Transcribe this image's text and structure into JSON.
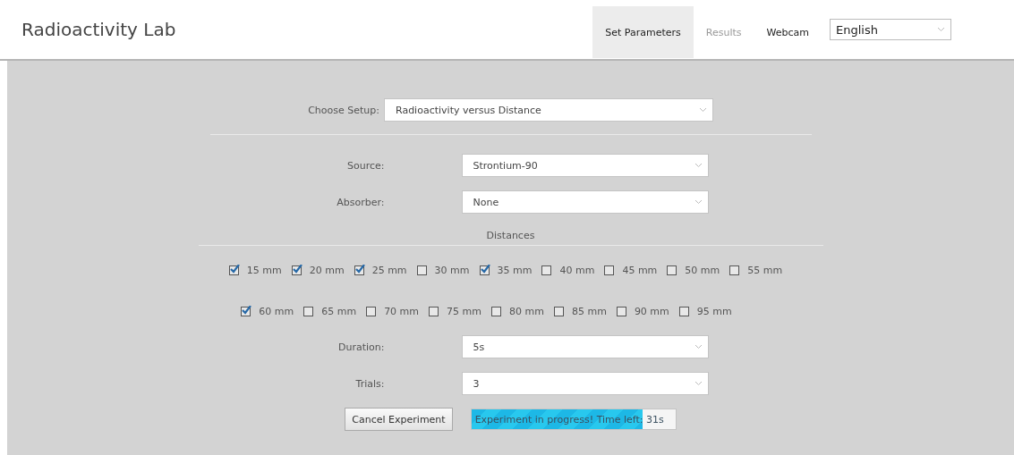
{
  "header": {
    "title": "Radioactivity Lab",
    "tabs": [
      {
        "label": "Set Parameters",
        "selected": true,
        "disabled": false
      },
      {
        "label": "Results",
        "selected": false,
        "disabled": true
      },
      {
        "label": "Webcam",
        "selected": false,
        "disabled": false
      }
    ],
    "language": "English"
  },
  "setup": {
    "label": "Choose Setup:",
    "value": "Radioactivity versus Distance"
  },
  "fields_top": [
    {
      "label": "Source:",
      "value": "Strontium-90"
    },
    {
      "label": "Absorber:",
      "value": "None"
    }
  ],
  "distances": {
    "title": "Distances",
    "rows": [
      [
        {
          "label": "15 mm",
          "checked": true
        },
        {
          "label": "20 mm",
          "checked": true
        },
        {
          "label": "25 mm",
          "checked": true
        },
        {
          "label": "30 mm",
          "checked": false
        },
        {
          "label": "35 mm",
          "checked": true
        },
        {
          "label": "40 mm",
          "checked": false
        },
        {
          "label": "45 mm",
          "checked": false
        },
        {
          "label": "50 mm",
          "checked": false
        },
        {
          "label": "55 mm",
          "checked": false
        }
      ],
      [
        {
          "label": "60 mm",
          "checked": true
        },
        {
          "label": "65 mm",
          "checked": false
        },
        {
          "label": "70 mm",
          "checked": false
        },
        {
          "label": "75 mm",
          "checked": false
        },
        {
          "label": "80 mm",
          "checked": false
        },
        {
          "label": "85 mm",
          "checked": false
        },
        {
          "label": "90 mm",
          "checked": false
        },
        {
          "label": "95 mm",
          "checked": false
        }
      ]
    ]
  },
  "fields_bottom": [
    {
      "label": "Duration:",
      "value": "5s"
    },
    {
      "label": "Trials:",
      "value": "3"
    }
  ],
  "cancel_button": "Cancel Experiment",
  "progress": {
    "text": "Experiment in progress! Time left: 31s",
    "level": 0.84
  }
}
